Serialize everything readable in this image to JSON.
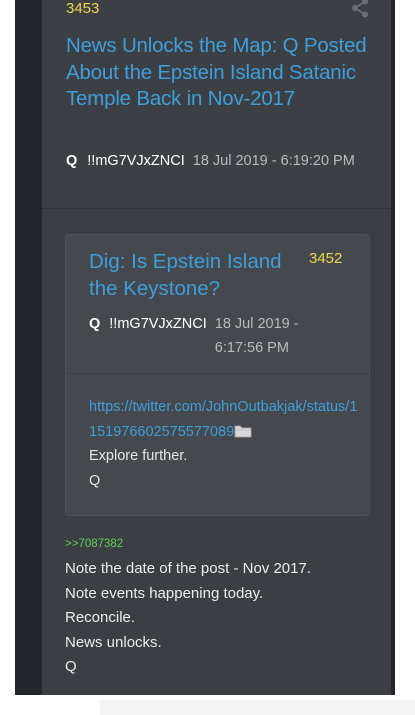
{
  "post": {
    "number": "3453",
    "title": "News Unlocks the Map: Q Posted About the Epstein Island Satanic Temple Back in Nov-2017",
    "author": "Q",
    "tripcode": "!!mG7VJxZNCI",
    "date": "18 Jul 2019 - 6:19:20 PM"
  },
  "quoted": {
    "title": "Dig: Is Epstein Island the Keystone?",
    "number": "3452",
    "author": "Q",
    "tripcode": "!!mG7VJxZNCI",
    "date": "18 Jul 2019 - 6:17:56 PM",
    "link": "https://twitter.com/JohnOutbakjak/status/1151976602575577089",
    "lines": [
      "Explore further.",
      "Q"
    ]
  },
  "reply": {
    "ref": ">>7087382",
    "lines": [
      "Note the date of the post - Nov 2017.",
      "Note events happening today.",
      "Reconcile.",
      "News unlocks.",
      "Q"
    ]
  },
  "icons": {
    "share": "share-icon",
    "folder": "folder-icon"
  },
  "colors": {
    "link": "#3e9fdc",
    "post_number": "#f0d64a",
    "reply_ref": "#5fd35a",
    "card": "#3b3e43"
  }
}
